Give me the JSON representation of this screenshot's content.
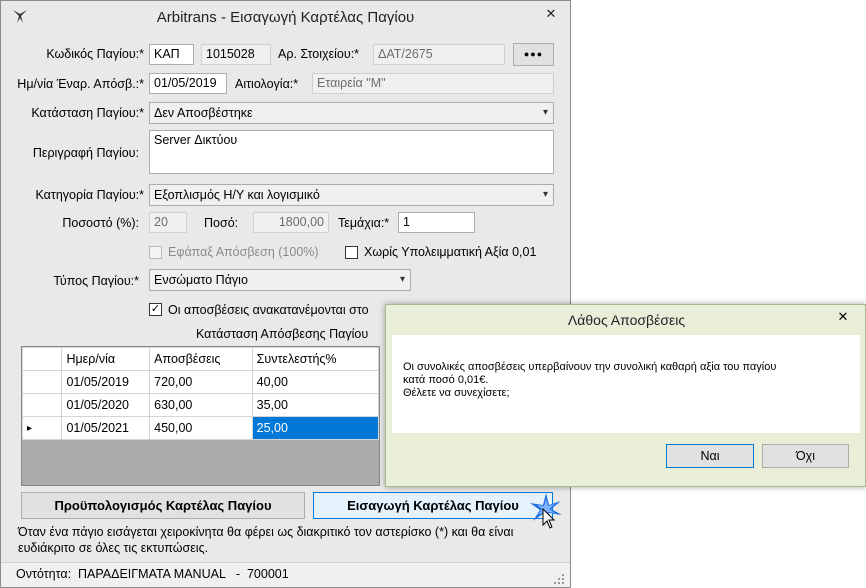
{
  "window": {
    "title": "Arbitrans - Εισαγωγή Καρτέλας Παγίου",
    "close": "✕"
  },
  "form": {
    "code_label": "Κωδικός Παγίου:*",
    "code_prefix": "ΚΑΠ",
    "code_number": "1015028",
    "doc_label": "Αρ. Στοιχείου:*",
    "doc_value": "ΔΑΤ/2675",
    "more_btn": "●●●",
    "date_label": "Ημ/νία Έναρ. Απόσβ.:*",
    "date_value": "01/05/2019",
    "reason_label": "Αιτιολογία:*",
    "reason_value": "Εταιρεία \"Μ\"",
    "status_label": "Κατάσταση Παγίου:*",
    "status_value": "Δεν Αποσβέστηκε",
    "desc_label": "Περιγραφή Παγίου:",
    "desc_value": "Server Δικτύου",
    "category_label": "Κατηγορία Παγίου:*",
    "category_value": "Εξοπλισμός Η/Υ και λογισμικό",
    "percent_label": "Ποσοστό (%):",
    "percent_value": "20",
    "amount_label": "Ποσό:",
    "amount_value": "1800,00",
    "pieces_label": "Τεμάχια:*",
    "pieces_value": "1",
    "lump_label": "Εφάπαξ Απόσβεση (100%)",
    "residual_label": "Χωρίς Υπολειμματική Αξία 0,01",
    "type_label": "Τύπος Παγίου:*",
    "type_value": "Ενσώματο Πάγιο",
    "redistribute_label": "Οι αποσβέσεις ανακατανέμονται στο",
    "depr_status_label": "Κατάσταση Απόσβεσης Παγίου"
  },
  "grid": {
    "columns": [
      "Ημερ/νία",
      "Αποσβέσεις",
      "Συντελεστής%"
    ],
    "rows": [
      [
        "01/05/2019",
        "720,00",
        "40,00"
      ],
      [
        "01/05/2020",
        "630,00",
        "35,00"
      ],
      [
        "01/05/2021",
        "450,00",
        "25,00"
      ]
    ],
    "current_row_marker": "▸"
  },
  "buttons": {
    "preview": "Προϋπολογισμός Καρτέλας Παγίου",
    "insert": "Εισαγωγή Καρτέλας Παγίου"
  },
  "note": "Όταν ένα πάγιο εισάγεται χειροκίνητα θα φέρει ως διακριτικό τον αστερίσκο (*) και θα είναι ευδιάκριτο σε όλες τις εκτυπώσεις.",
  "status_bar": {
    "label": "Οντότητα:",
    "value": "ΠΑΡΑΔΕΙΓΜΑΤΑ MANUAL   -  700001"
  },
  "dialog": {
    "title": "Λάθος Αποσβέσεις",
    "close": "✕",
    "message": "Οι συνολικές αποσβέσεις υπερβαίνουν την συνολική καθαρή αξία του παγίου\nκατά ποσό 0,01€.\nΘέλετε να συνεχίσετε;",
    "yes": "Ναι",
    "no": "Όχι"
  },
  "colors": {
    "selection": "#0078d7",
    "dialog_bg": "#e9eed9",
    "window_bg": "#e9e9e9"
  }
}
